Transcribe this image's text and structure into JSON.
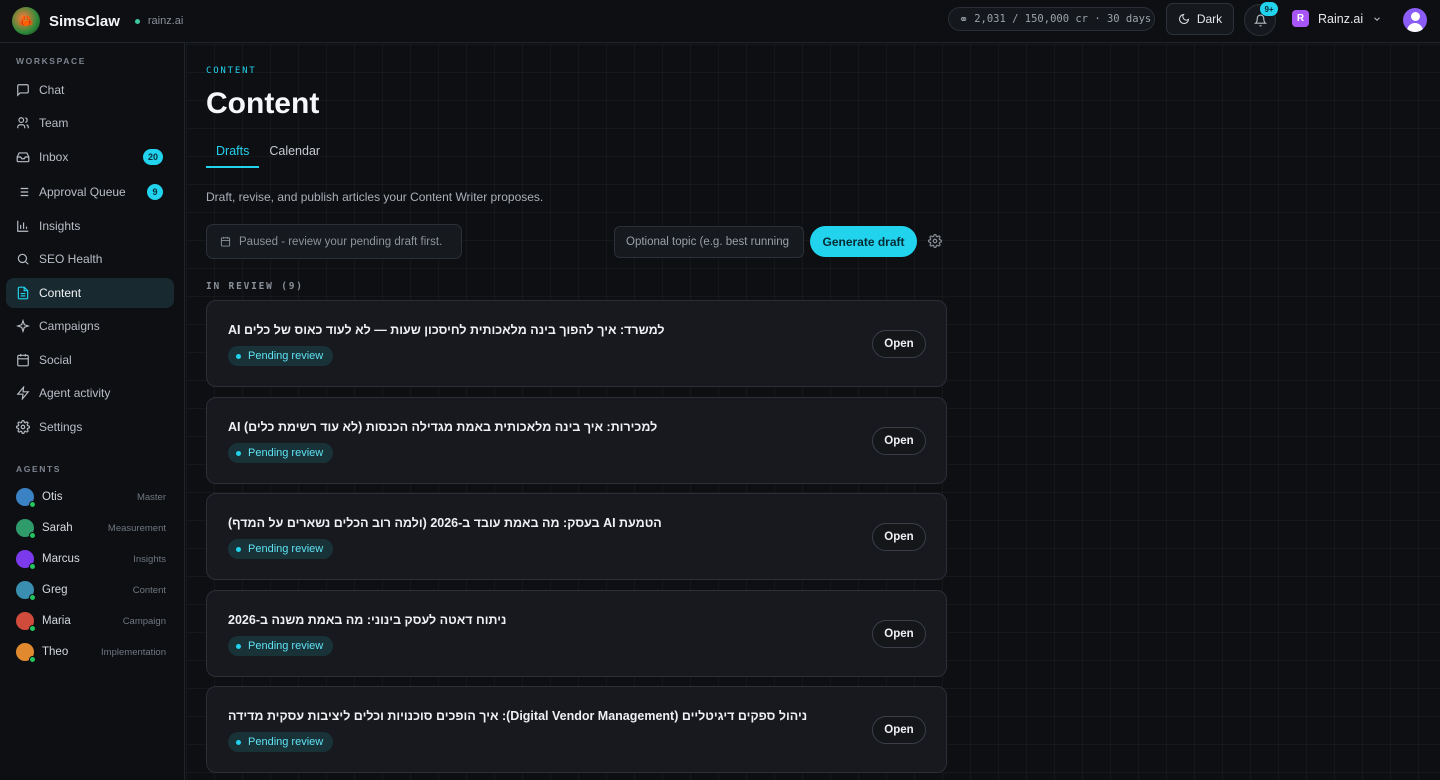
{
  "app": {
    "name": "SimsClaw",
    "workspace": "rainz.ai"
  },
  "topbar": {
    "credits": "2,031 / 150,000 cr · 30 days",
    "theme_label": "Dark",
    "notif_count": "9+",
    "org_initial": "R",
    "org_name": "Rainz.ai"
  },
  "sidebar": {
    "workspace_label": "WORKSPACE",
    "items": [
      {
        "label": "Chat",
        "icon": "chat-icon"
      },
      {
        "label": "Team",
        "icon": "team-icon"
      },
      {
        "label": "Inbox",
        "icon": "inbox-icon",
        "badge": "20"
      },
      {
        "label": "Approval Queue",
        "icon": "list-icon",
        "badge": "9"
      },
      {
        "label": "Insights",
        "icon": "bar-chart-icon"
      },
      {
        "label": "SEO Health",
        "icon": "search-icon"
      },
      {
        "label": "Content",
        "icon": "document-icon",
        "active": true
      },
      {
        "label": "Campaigns",
        "icon": "sparkle-icon"
      },
      {
        "label": "Social",
        "icon": "calendar-icon"
      },
      {
        "label": "Agent activity",
        "icon": "bolt-icon"
      },
      {
        "label": "Settings",
        "icon": "gear-icon"
      }
    ],
    "agents_label": "AGENTS",
    "agents": [
      {
        "name": "Otis",
        "role": "Master",
        "color": "#3b82c4"
      },
      {
        "name": "Sarah",
        "role": "Measurement",
        "color": "#2f9a6a"
      },
      {
        "name": "Marcus",
        "role": "Insights",
        "color": "#7c3aed"
      },
      {
        "name": "Greg",
        "role": "Content",
        "color": "#3a8fb0"
      },
      {
        "name": "Maria",
        "role": "Campaign",
        "color": "#d14b3d"
      },
      {
        "name": "Theo",
        "role": "Implementation",
        "color": "#e0892f"
      }
    ]
  },
  "main": {
    "eyebrow": "CONTENT",
    "title": "Content",
    "tabs": [
      {
        "label": "Drafts",
        "active": true
      },
      {
        "label": "Calendar"
      }
    ],
    "description": "Draft, revise, and publish articles your Content Writer proposes.",
    "paused_text": "Paused - review your pending draft first.",
    "topic_placeholder": "Optional topic (e.g. best running",
    "generate_label": "Generate draft",
    "review_label": "IN REVIEW",
    "review_count": "(9)",
    "open_label": "Open",
    "drafts": [
      {
        "title": "למשרד: איך להפוך בינה מלאכותית לחיסכון שעות — לא לעוד כאוס של כלים AI",
        "status": "Pending review"
      },
      {
        "title": "למכירות: איך בינה מלאכותית באמת מגדילה הכנסות (לא עוד רשימת כלים) AI",
        "status": "Pending review"
      },
      {
        "title": "הטמעת AI בעסק: מה באמת עובד ב-2026 (ולמה רוב הכלים נשארים על המדף)",
        "status": "Pending review"
      },
      {
        "title": "ניתוח דאטה לעסק בינוני: מה באמת משנה ב-2026",
        "status": "Pending review"
      },
      {
        "title": "ניהול ספקים דיגיטליים (Digital Vendor Management): איך הופכים סוכנויות וכלים ליציבות עסקית מדידה",
        "status": "Pending review"
      }
    ]
  }
}
